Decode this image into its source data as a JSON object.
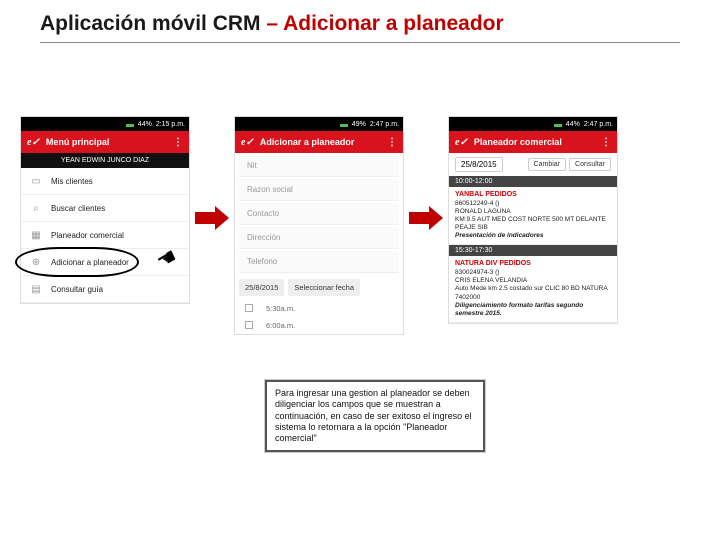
{
  "title_prefix": "Aplicación móvil CRM ",
  "title_accent": "– Adicionar a planeador",
  "phone1": {
    "status": {
      "battery": "44%",
      "time": "2:15 p.m."
    },
    "appbar": "Menú principal",
    "user": "YEAN EDWIN JUNCO DIAZ",
    "items": [
      "Mis clientes",
      "Buscar clientes",
      "Planeador comercial",
      "Adicionar a planeador",
      "Consultar guía"
    ]
  },
  "phone2": {
    "status": {
      "battery": "49%",
      "time": "2:47 p.m."
    },
    "appbar": "Adicionar a planeador",
    "fields": [
      "Nit",
      "Razon social",
      "Contacto",
      "Dirección",
      "Telefono"
    ],
    "date": "25/8/2015",
    "date_btn": "Seleccionar fecha",
    "times": [
      "5:30a.m.",
      "6:00a.m."
    ]
  },
  "phone3": {
    "status": {
      "battery": "44%",
      "time": "2:47 p.m."
    },
    "appbar": "Planeador comercial",
    "date": "25/8/2015",
    "btn_change": "Cambiar",
    "btn_consult": "Consultar",
    "slot1": "10:00-12:00",
    "card1": {
      "title": "YANBAL PEDIDOS",
      "nit": "860512249-4 ()",
      "contact": "RONALD LAGUNA",
      "addr": "KM 9.5 AUT MED COST NORTE 500 MT DELANTE PEAJE SIB",
      "subject": "Presentación de indicadores"
    },
    "slot2": "15:30-17:30",
    "card2": {
      "title": "NATURA DIV PEDIDOS",
      "nit": "830024974-3 ()",
      "contact": "CRIS ELENA VELANDIA",
      "addr": "Auto Mede km 2.5 costado sur CLIC 80 BD NATURA",
      "phone": "7402000",
      "subject": "Diligenciamiento formato tarifas segundo semestre 2015."
    }
  },
  "callout": "Para ingresar una gestion al planeador se deben diligenciar los campos que se muestran a continuación, en caso de ser exitoso el ingreso el sistema lo retornara a la opción \"Planeador comercial\""
}
